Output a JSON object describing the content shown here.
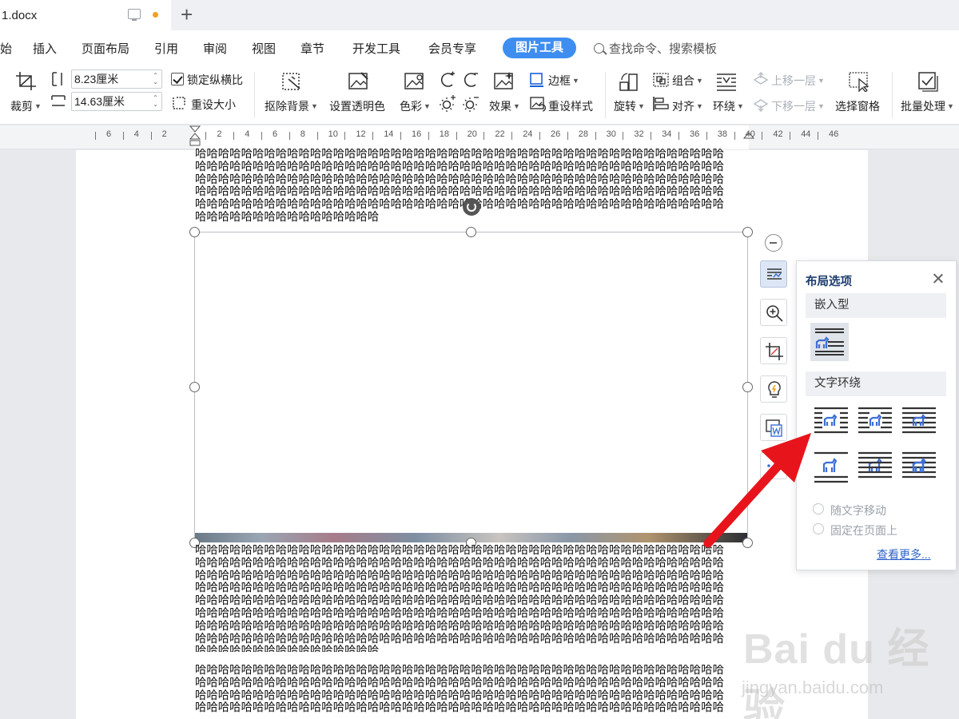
{
  "tab": {
    "doc_name": "1.docx",
    "new_tab": "+"
  },
  "menu": {
    "items": [
      {
        "label": "始"
      },
      {
        "label": "插入"
      },
      {
        "label": "页面布局"
      },
      {
        "label": "引用"
      },
      {
        "label": "审阅"
      },
      {
        "label": "视图"
      },
      {
        "label": "章节"
      },
      {
        "label": "开发工具"
      },
      {
        "label": "会员专享"
      }
    ],
    "active": "图片工具",
    "search_placeholder": "查找命令、搜索模板"
  },
  "ribbon": {
    "crop": "裁剪",
    "height_value": "8.23厘米",
    "width_value": "14.63厘米",
    "lock_ratio": "锁定纵横比",
    "reset_size": "重设大小",
    "remove_bg": "抠除背景",
    "transparent": "设置透明色",
    "color": "色彩",
    "effects": "效果",
    "border": "边框",
    "reset_style": "重设样式",
    "rotate": "旋转",
    "group": "组合",
    "align": "对齐",
    "wrap": "环绕",
    "bring_forward": "上移一层",
    "send_backward": "下移一层",
    "selection_pane": "选择窗格",
    "batch": "批量处理"
  },
  "ruler": {
    "labels": [
      "6",
      "4",
      "2",
      "2",
      "4",
      "6",
      "8",
      "10",
      "12",
      "14",
      "16",
      "18",
      "20",
      "22",
      "24",
      "26",
      "28",
      "30",
      "32",
      "34",
      "36",
      "38",
      "40",
      "42",
      "44",
      "46"
    ]
  },
  "document": {
    "line_full": "哈哈哈哈哈哈哈哈哈哈哈哈哈哈哈哈哈哈哈哈哈哈哈哈哈哈哈哈哈哈哈哈哈哈哈哈哈哈哈哈哈哈哈哈哈哈",
    "line_short": "哈哈哈哈哈哈哈哈哈哈哈哈哈哈哈哈"
  },
  "layout_popup": {
    "title": "布局选项",
    "inline_section": "嵌入型",
    "wrap_section": "文字环绕",
    "move_with_text": "随文字移动",
    "fix_on_page": "固定在页面上",
    "see_more": "查看更多..."
  },
  "watermark": {
    "brand": "Bai du 经验",
    "url": "jingyan.baidu.com"
  },
  "colors": {
    "accent": "#3d8ef0",
    "arrow": "#e8141c",
    "link": "#2e64c7"
  }
}
